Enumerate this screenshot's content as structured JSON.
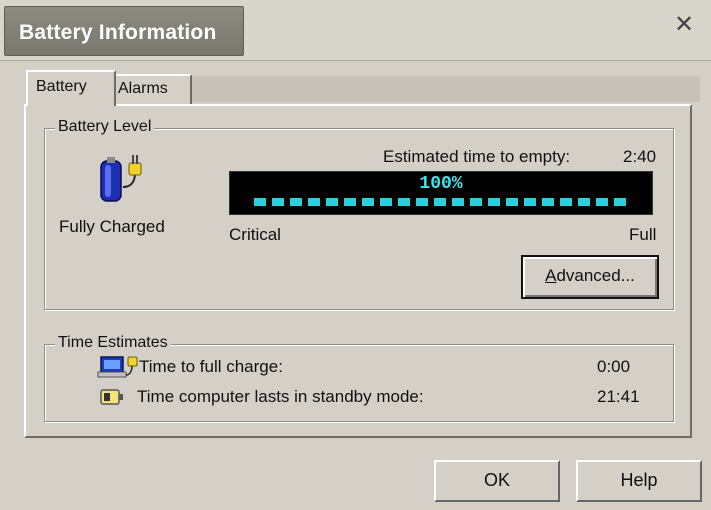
{
  "window": {
    "title": "Battery Information"
  },
  "tabs": [
    {
      "label": "Battery"
    },
    {
      "label": "Alarms"
    }
  ],
  "battery_level": {
    "group_label": "Battery Level",
    "status": "Fully Charged",
    "estimated_label": "Estimated time to empty:",
    "estimated_value": "2:40",
    "percent_text": "100%",
    "percent_value": 100,
    "critical_label": "Critical",
    "full_label": "Full",
    "advanced_prefix": "A",
    "advanced_suffix": "dvanced..."
  },
  "time_estimates": {
    "group_label": "Time Estimates",
    "rows": [
      {
        "label": "Time to full charge:",
        "value": "0:00"
      },
      {
        "label": "Time computer lasts in standby mode:",
        "value": "21:41"
      }
    ]
  },
  "buttons": {
    "ok": "OK",
    "help": "Help"
  },
  "icons": {
    "battery": "battery-plug-icon",
    "laptop": "laptop-plug-icon",
    "standby": "standby-battery-icon",
    "close": "close-icon"
  },
  "colors": {
    "meter_text": "#3de6ee",
    "meter_bar": "#27d0dc",
    "title_bg": "#7a776f"
  }
}
